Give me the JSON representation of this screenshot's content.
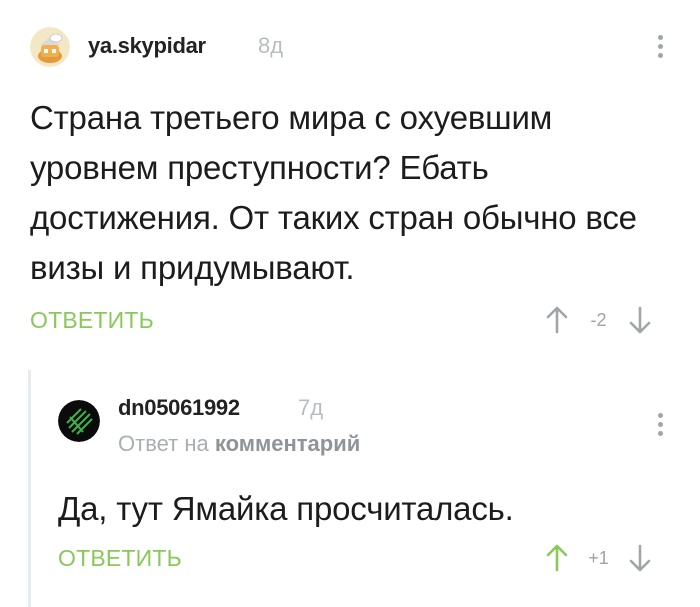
{
  "comments": [
    {
      "username": "ya.skypidar",
      "time": "8д",
      "text": "Страна третьего мира с охуевшим уровнем преступности? Ебать достижения. От таких стран обычно все визы и придумывают.",
      "reply_label": "ОТВЕТИТЬ",
      "rating": "-2",
      "upvoted": false
    },
    {
      "username": "dn05061992",
      "time": "7д",
      "reply_prefix": "Ответ на",
      "reply_target": "комментарий",
      "text": "Да, тут Ямайка просчиталась.",
      "reply_label": "ОТВЕТИТЬ",
      "rating": "+1",
      "upvoted": true
    }
  ],
  "colors": {
    "accent_green": "#8ac858",
    "arrow_gray": "#a0a5aa",
    "thread_line": "#e8ebee"
  },
  "icons": {
    "more": "vertical-dots-icon",
    "upvote": "arrow-up-icon",
    "downvote": "arrow-down-icon"
  }
}
